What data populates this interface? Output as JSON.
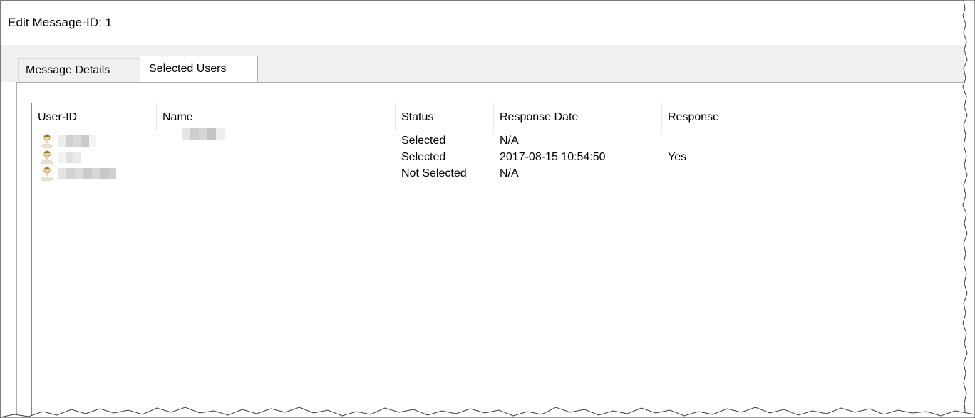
{
  "window": {
    "title": "Edit Message-ID: 1"
  },
  "tabs": [
    {
      "label": "Message Details",
      "active": false
    },
    {
      "label": "Selected Users",
      "active": true
    }
  ],
  "list": {
    "columns": [
      "User-ID",
      "Name",
      "Status",
      "Response Date",
      "Response"
    ],
    "rows": [
      {
        "icon": "user-icon",
        "user_id": "",
        "name": "",
        "status": "Selected",
        "response_date": "N/A",
        "response": ""
      },
      {
        "icon": "user-icon",
        "user_id": "",
        "name": "",
        "status": "Selected",
        "response_date": "2017-08-15 10:54:50",
        "response": "Yes"
      },
      {
        "icon": "user-icon",
        "user_id": "",
        "name": "",
        "status": "Not Selected",
        "response_date": "N/A",
        "response": ""
      }
    ]
  },
  "colors": {
    "tab_strip_bg": "#f0f0f0",
    "border": "#adadad",
    "list_bg": "#ffffff"
  }
}
